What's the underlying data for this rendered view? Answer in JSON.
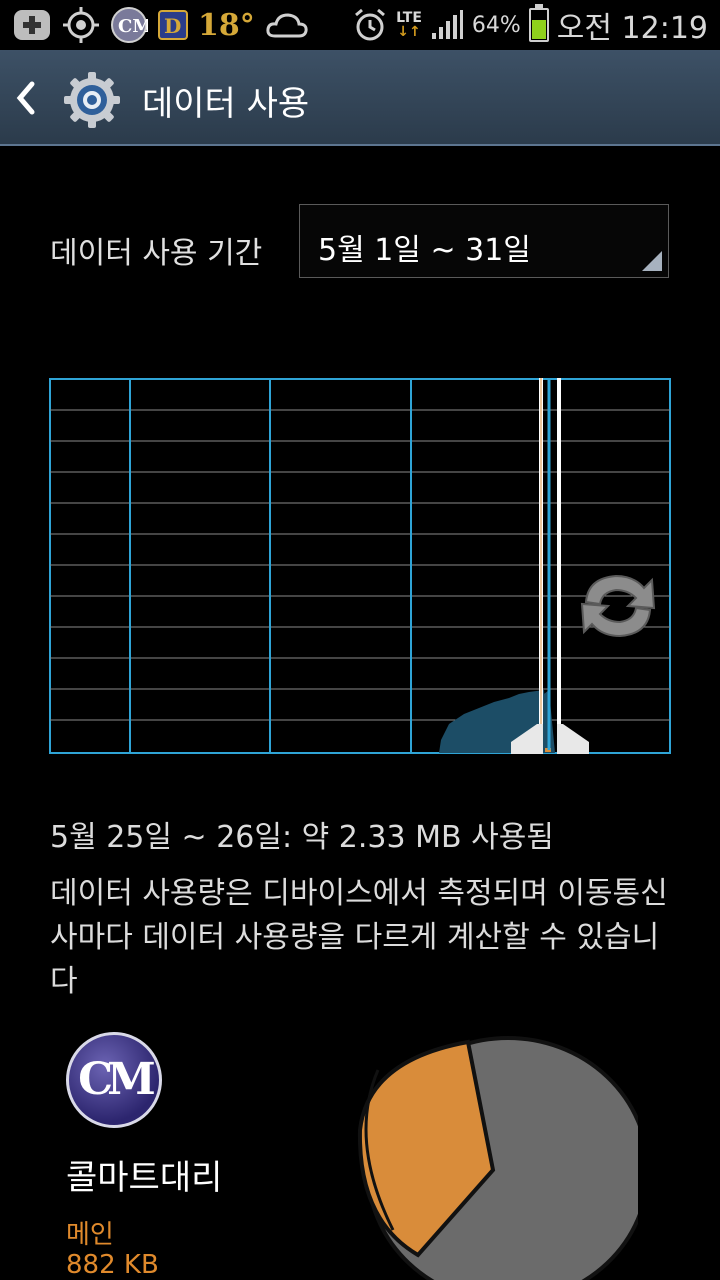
{
  "status_bar": {
    "temperature": "18°",
    "network": "LTE",
    "battery_percent": "64%",
    "time": "오전 12:19",
    "battery_level": 0.64,
    "icons": [
      "add-icon",
      "gps-icon",
      "app-cm-icon",
      "app-d-icon",
      "cloud-icon",
      "alarm-icon",
      "lte-data-icon",
      "signal-icon",
      "battery-icon"
    ]
  },
  "action_bar": {
    "title": "데이터 사용",
    "back_icon": "chevron-left-icon",
    "app_icon": "gear-icon"
  },
  "period": {
    "label": "데이터 사용 기간",
    "value": "5월 1일 ~ 31일"
  },
  "usage": {
    "summary": "5월 25일 ~ 26일: 약 2.33 MB 사용됨",
    "note": "데이터 사용량은 디바이스에서 측정되며 이동통신사마다 데이터 사용량을 다르게 계산할 수 있습니다"
  },
  "app": {
    "name": "콜마트대리",
    "sub_label": "메인",
    "sub_value": "882 KB",
    "avatar_text": "CM"
  },
  "colors": {
    "grid": "#2fa4d6",
    "fill": "#1c4d66",
    "accent_orange": "#d98c3a",
    "pie_gray": "#6b6b6b"
  }
}
